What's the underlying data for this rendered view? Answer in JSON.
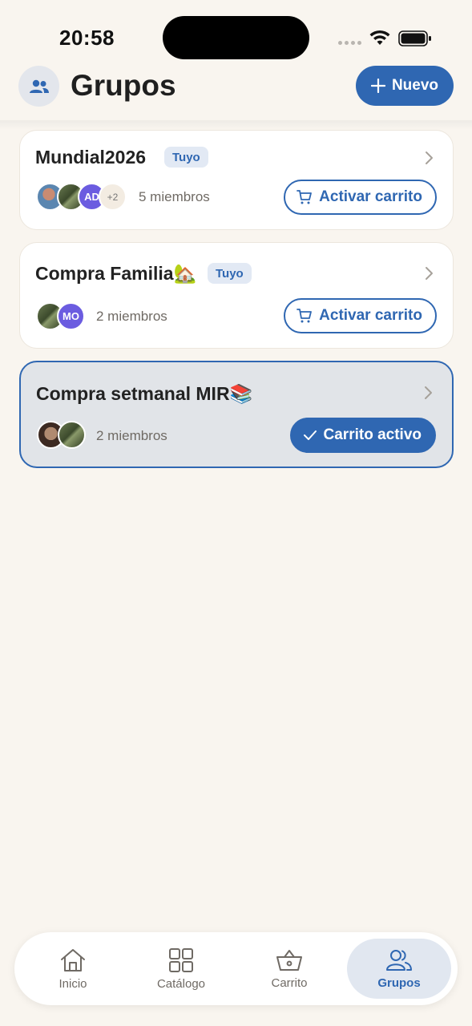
{
  "status_bar": {
    "time": "20:58"
  },
  "header": {
    "title": "Grupos",
    "new_button_label": "Nuevo"
  },
  "groups": [
    {
      "title": "Mundial2026",
      "badge": "Tuyo",
      "avatars": [
        "",
        "",
        "AD",
        "+2"
      ],
      "members_text": "5 miembros",
      "cart_button_label": "Activar carrito",
      "active": false
    },
    {
      "title": "Compra Familia🏡",
      "badge": "Tuyo",
      "avatars": [
        "",
        "MO"
      ],
      "members_text": "2 miembros",
      "cart_button_label": "Activar carrito",
      "active": false
    },
    {
      "title": "Compra setmanal MIR📚",
      "badge": "",
      "avatars": [
        "",
        ""
      ],
      "members_text": "2 miembros",
      "cart_button_label": "Carrito activo",
      "active": true
    }
  ],
  "bottom_nav": {
    "items": [
      {
        "label": "Inicio",
        "icon": "home-icon",
        "selected": false
      },
      {
        "label": "Catálogo",
        "icon": "grid-icon",
        "selected": false
      },
      {
        "label": "Carrito",
        "icon": "basket-icon",
        "selected": false
      },
      {
        "label": "Grupos",
        "icon": "users-icon",
        "selected": true
      }
    ]
  },
  "colors": {
    "accent": "#2f67b2",
    "background": "#f9f5ef",
    "active_card": "#e1e4e8"
  }
}
